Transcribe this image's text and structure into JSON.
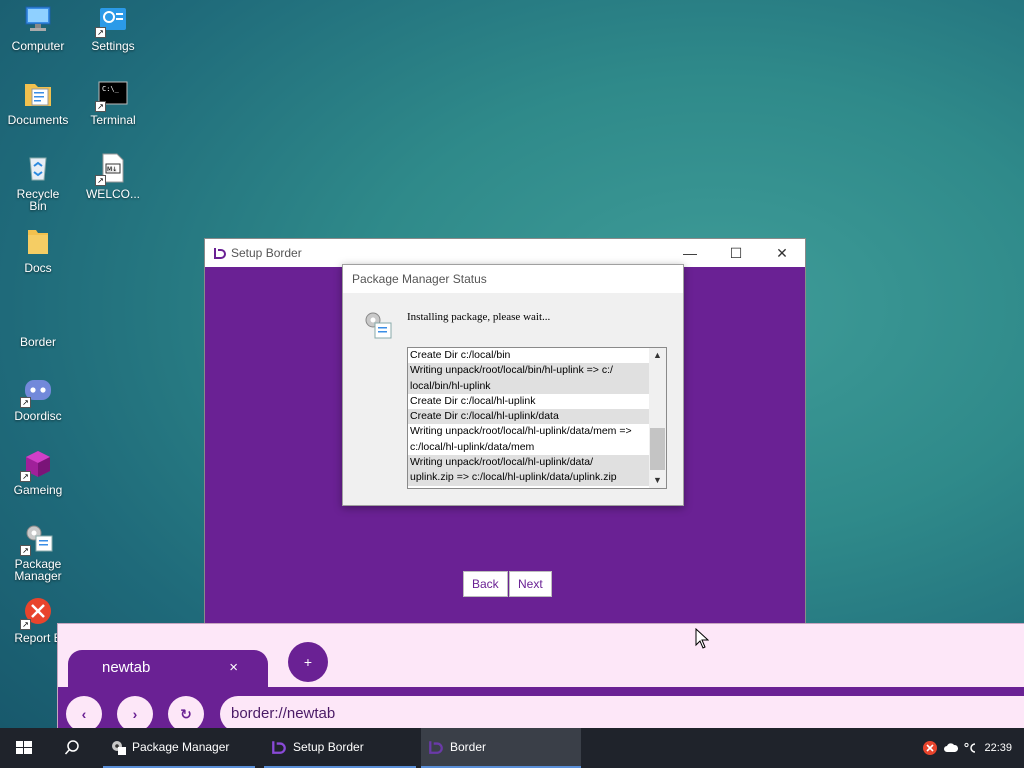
{
  "desktop": {
    "icons": [
      {
        "label": "Computer"
      },
      {
        "label": "Settings"
      },
      {
        "label": "Documents"
      },
      {
        "label": "Terminal"
      },
      {
        "label": "Recycle Bin"
      },
      {
        "label": "WELCO..."
      },
      {
        "label": "Docs"
      },
      {
        "label": "Border"
      },
      {
        "label": "Doordisc"
      },
      {
        "label": "Gameing"
      },
      {
        "label": "Package Manager"
      },
      {
        "label": "Report B"
      }
    ]
  },
  "setup_window": {
    "title": "Setup Border",
    "back_label": "Back",
    "next_label": "Next"
  },
  "pm_dialog": {
    "title": "Package Manager Status",
    "message": "Installing package, please wait...",
    "log": [
      "Create Dir c:/local/bin",
      "Writing unpack/root/local/bin/hl-uplink => c:/",
      "local/bin/hl-uplink",
      "Create Dir c:/local/hl-uplink",
      "Create Dir c:/local/hl-uplink/data",
      "Writing unpack/root/local/hl-uplink/data/mem =>",
      "c:/local/hl-uplink/data/mem",
      "Writing unpack/root/local/hl-uplink/data/",
      "uplink.zip => c:/local/hl-uplink/data/uplink.zip"
    ]
  },
  "browser": {
    "tab_label": "newtab",
    "tab_close": "×",
    "new_tab": "+",
    "back": "‹",
    "forward": "›",
    "reload": "↻",
    "url": "border://newtab"
  },
  "taskbar": {
    "apps": [
      {
        "label": "Package Manager"
      },
      {
        "label": "Setup Border"
      },
      {
        "label": "Border"
      }
    ],
    "clock": "22:39"
  }
}
